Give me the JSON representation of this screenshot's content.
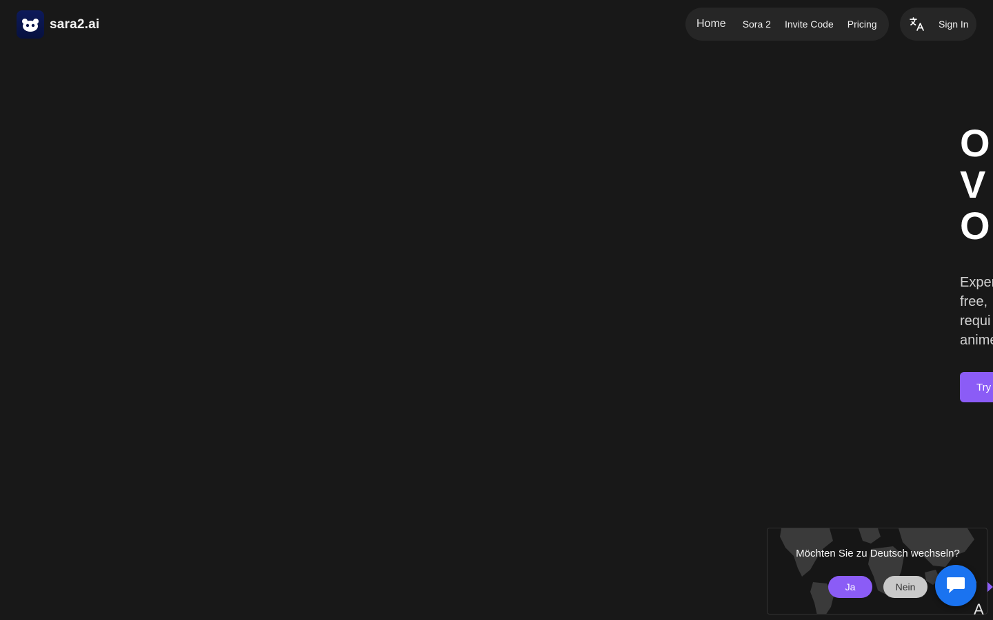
{
  "header": {
    "logo_text": "sara2.ai",
    "logo_icon": "robot-face-icon",
    "nav": {
      "home": "Home",
      "sora2": "Sora 2",
      "invite_code": "Invite Code",
      "pricing": "Pricing"
    },
    "translate_icon": "translate-icon",
    "sign_in": "Sign In"
  },
  "hero": {
    "title_lines": [
      "O",
      "V",
      "O"
    ],
    "subtitle_lines": [
      "Exper",
      "free,",
      "requi",
      "anime"
    ],
    "cta": "Try"
  },
  "lang_popup": {
    "question": "Möchten Sie zu Deutsch wechseln?",
    "yes": "Ja",
    "no": "Nein"
  },
  "chat": {
    "icon": "chat-bubble-icon"
  },
  "colors": {
    "background": "#181818",
    "accent": "#8b5cf6",
    "chat_blue": "#1a73f0",
    "pill": "#262626"
  }
}
